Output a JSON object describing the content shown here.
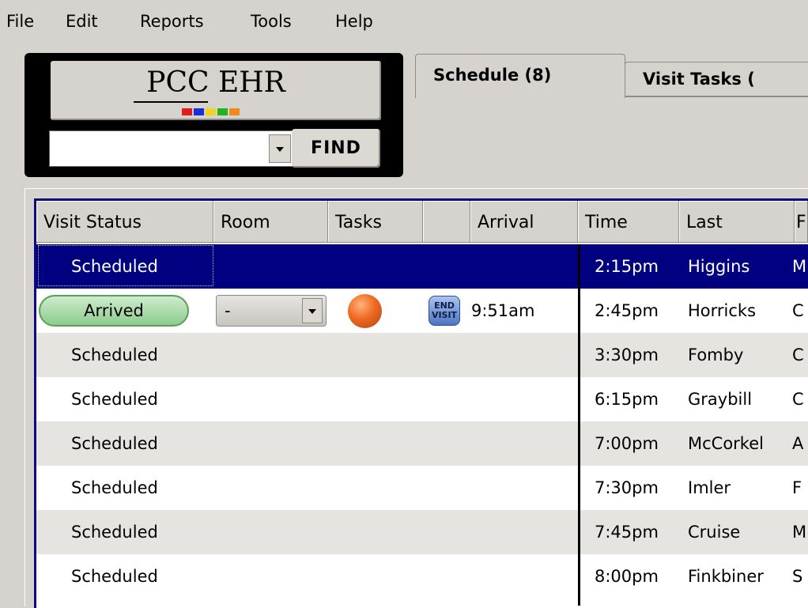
{
  "menu": [
    "File",
    "Edit",
    "Reports",
    "Tools",
    "Help"
  ],
  "logo": {
    "text": "PCC EHR",
    "square_colors": [
      "#e21b1b",
      "#1431d6",
      "#f2d41b",
      "#23b41d",
      "#f28a1b"
    ]
  },
  "search": {
    "find_label": "FIND",
    "value": ""
  },
  "tabs": {
    "schedule": "Schedule (8)",
    "visit_tasks": "Visit Tasks ("
  },
  "columns": {
    "status": "Visit Status",
    "room": "Room",
    "tasks": "Tasks",
    "blank": "",
    "arrival": "Arrival",
    "time": "Time",
    "last": "Last",
    "first": "F"
  },
  "rows": [
    {
      "status": "Scheduled",
      "time": "2:15pm",
      "last": "Higgins",
      "first": "M"
    },
    {
      "status": "Arrived",
      "room": "-",
      "end_visit": "END VISIT",
      "arrival": "9:51am",
      "time": "2:45pm",
      "last": "Horricks",
      "first": "C"
    },
    {
      "status": "Scheduled",
      "time": "3:30pm",
      "last": "Fomby",
      "first": "C"
    },
    {
      "status": "Scheduled",
      "time": "6:15pm",
      "last": "Graybill",
      "first": "C"
    },
    {
      "status": "Scheduled",
      "time": "7:00pm",
      "last": "McCorkel",
      "first": "A"
    },
    {
      "status": "Scheduled",
      "time": "7:30pm",
      "last": "Imler",
      "first": "F"
    },
    {
      "status": "Scheduled",
      "time": "7:45pm",
      "last": "Cruise",
      "first": "M"
    },
    {
      "status": "Scheduled",
      "time": "8:00pm",
      "last": "Finkbiner",
      "first": "S"
    }
  ],
  "colors": {
    "selection": "#000080",
    "arrived_pill": "#8ccc8c",
    "task_indicator": "#ef6a22",
    "end_visit_button": "#4e75c2"
  },
  "icons": {
    "task_indicator": "orange-ball-icon",
    "end_visit": "end-visit-icon"
  }
}
